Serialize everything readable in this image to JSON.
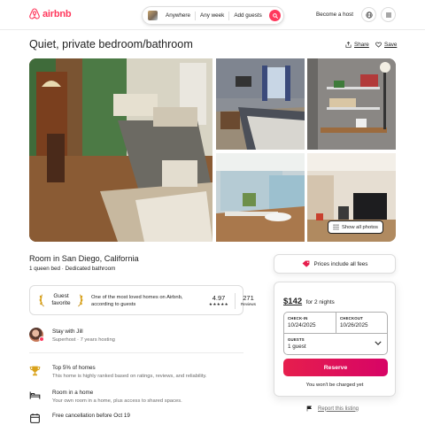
{
  "header": {
    "logo_text": "airbnb",
    "search": {
      "location": "Anywhere",
      "dates": "Any week",
      "guests": "Add guests"
    },
    "become_host": "Become a host"
  },
  "listing": {
    "title": "Quiet, private bedroom/bathroom",
    "share_label": "Share",
    "save_label": "Save",
    "show_all_photos": "Show all photos",
    "room_title": "Room in San Diego, California",
    "room_sub": "1 queen bed · Dedicated bathroom"
  },
  "guest_favorite": {
    "label_line1": "Guest",
    "label_line2": "favorite",
    "description": "One of the most loved homes on Airbnb, according to guests",
    "rating": "4.97",
    "stars": "★★★★★",
    "reviews_count": "271",
    "reviews_label": "Reviews"
  },
  "host": {
    "name_line": "Stay with Jill",
    "sub_line": "Superhost · 7 years hosting"
  },
  "features": [
    {
      "icon": "trophy-icon",
      "title": "Top 5% of homes",
      "desc": "This home is highly ranked based on ratings, reviews, and reliability."
    },
    {
      "icon": "bed-icon",
      "title": "Room in a home",
      "desc": "Your own room in a home, plus access to shared spaces."
    },
    {
      "icon": "calendar-icon",
      "title": "Free cancellation before Oct 19",
      "desc": ""
    }
  ],
  "booking": {
    "prices_include": "Prices include all fees",
    "price": "$142",
    "price_for": "for 2 nights",
    "checkin_label": "CHECK-IN",
    "checkin_value": "10/24/2025",
    "checkout_label": "CHECKOUT",
    "checkout_value": "10/26/2025",
    "guests_label": "GUESTS",
    "guests_value": "1 guest",
    "reserve_label": "Reserve",
    "no_charge": "You won't be charged yet",
    "report": "Report this listing"
  },
  "colors": {
    "brand": "#ff385c",
    "reserve_start": "#e61e4d",
    "reserve_end": "#d70466",
    "text": "#222222",
    "muted": "#6a6a6a"
  }
}
